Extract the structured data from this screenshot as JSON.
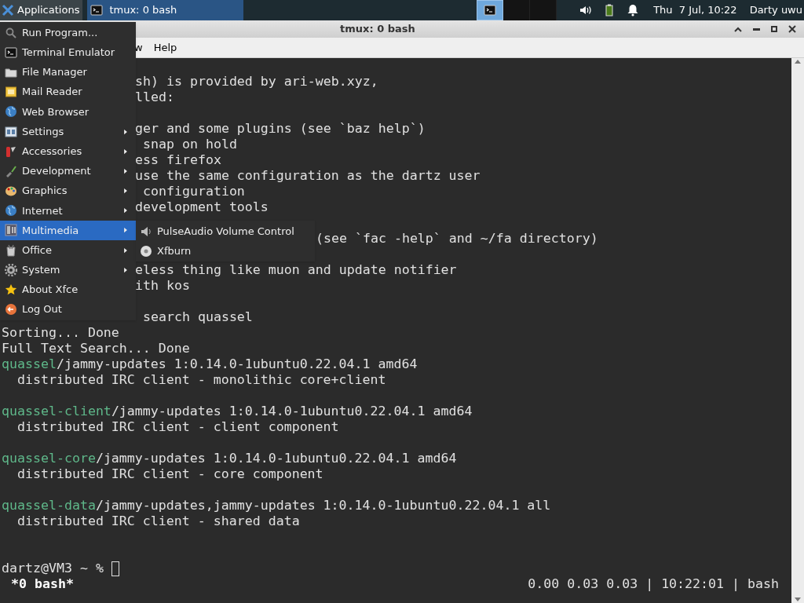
{
  "panel": {
    "apps_button": "Applications",
    "task": {
      "title": "tmux: 0 bash",
      "selected": true
    },
    "workspaces": [
      {
        "selected": true
      },
      {
        "selected": false
      },
      {
        "selected": false
      }
    ],
    "clock": "Thu  7 Jul, 10:22",
    "user": "Darty uwu"
  },
  "window": {
    "title": "tmux: 0 bash",
    "menu_bar": [
      "w",
      "Help"
    ]
  },
  "terminal": {
    "lines": [
      {
        "kind": "behind_menu",
        "text": "sh) is provided by ari-web.xyz,"
      },
      {
        "kind": "behind_menu",
        "text": "lled:"
      },
      {
        "kind": "blank"
      },
      {
        "kind": "behind_menu",
        "text": "ger and some plugins (see `baz help`)"
      },
      {
        "kind": "behind_menu",
        "text": " snap on hold"
      },
      {
        "kind": "behind_menu",
        "text": "ess firefox"
      },
      {
        "kind": "behind_menu",
        "text": "use the same configuration as the dartz user"
      },
      {
        "kind": "behind_menu",
        "text": " configuration"
      },
      {
        "kind": "behind_menu",
        "text": "development tools"
      },
      {
        "kind": "blank"
      },
      {
        "kind": "behind_submenu",
        "text": "(see `fac -help` and ~/fa directory)"
      },
      {
        "kind": "blank"
      },
      {
        "kind": "behind_menu",
        "text": "eless thing like muon and update notifier"
      },
      {
        "kind": "behind_menu",
        "text": "ith kos"
      },
      {
        "kind": "blank"
      },
      {
        "kind": "behind_menu",
        "text": " search quassel"
      },
      {
        "kind": "plain",
        "text": "Sorting... Done"
      },
      {
        "kind": "plain",
        "text": "Full Text Search... Done"
      },
      {
        "kind": "package",
        "package": "quassel",
        "text": "/jammy-updates 1:0.14.0-1ubuntu0.22.04.1 amd64"
      },
      {
        "kind": "plain",
        "text": "  distributed IRC client - monolithic core+client"
      },
      {
        "kind": "blank"
      },
      {
        "kind": "package",
        "package": "quassel-client",
        "text": "/jammy-updates 1:0.14.0-1ubuntu0.22.04.1 amd64"
      },
      {
        "kind": "plain",
        "text": "  distributed IRC client - client component"
      },
      {
        "kind": "blank"
      },
      {
        "kind": "package",
        "package": "quassel-core",
        "text": "/jammy-updates 1:0.14.0-1ubuntu0.22.04.1 amd64"
      },
      {
        "kind": "plain",
        "text": "  distributed IRC client - core component"
      },
      {
        "kind": "blank"
      },
      {
        "kind": "package",
        "package": "quassel-data",
        "text": "/jammy-updates,jammy-updates 1:0.14.0-1ubuntu0.22.04.1 all"
      },
      {
        "kind": "plain",
        "text": "  distributed IRC client - shared data"
      },
      {
        "kind": "blank"
      },
      {
        "kind": "blank"
      },
      {
        "kind": "prompt",
        "text": "dartz@VM3 ~ %"
      }
    ],
    "status_left": "*0 bash*",
    "status_right": "0.00 0.03 0.03 | 10:22:01 | bash"
  },
  "apps_menu": {
    "items": [
      {
        "label": "Run Program...",
        "submenu": false,
        "selected": false
      },
      {
        "label": "Terminal Emulator",
        "submenu": false,
        "selected": false
      },
      {
        "label": "File Manager",
        "submenu": false,
        "selected": false
      },
      {
        "label": "Mail Reader",
        "submenu": false,
        "selected": false
      },
      {
        "label": "Web Browser",
        "submenu": false,
        "selected": false
      },
      {
        "label": "Settings",
        "submenu": true,
        "selected": false
      },
      {
        "label": "Accessories",
        "submenu": true,
        "selected": false
      },
      {
        "label": "Development",
        "submenu": true,
        "selected": false
      },
      {
        "label": "Graphics",
        "submenu": true,
        "selected": false
      },
      {
        "label": "Internet",
        "submenu": true,
        "selected": false
      },
      {
        "label": "Multimedia",
        "submenu": true,
        "selected": true
      },
      {
        "label": "Office",
        "submenu": true,
        "selected": false
      },
      {
        "label": "System",
        "submenu": true,
        "selected": false
      },
      {
        "label": "About Xfce",
        "submenu": false,
        "selected": false
      },
      {
        "label": "Log Out",
        "submenu": false,
        "selected": false
      }
    ],
    "submenu": [
      {
        "label": "PulseAudio Volume Control"
      },
      {
        "label": "Xfburn"
      }
    ]
  }
}
